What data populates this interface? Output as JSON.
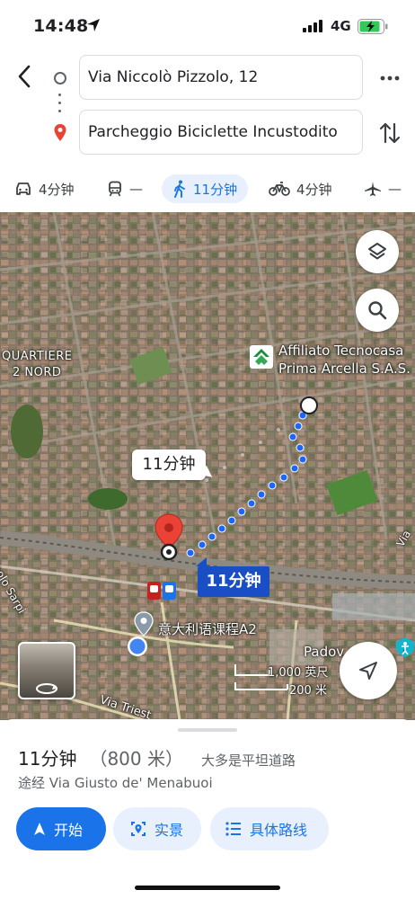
{
  "status_bar": {
    "time": "14:48",
    "network": "4G"
  },
  "route": {
    "origin": "Via Niccolò Pizzolo, 12",
    "destination": "Parcheggio Biciclette Incustodito"
  },
  "modes": [
    {
      "name": "drive",
      "icon": "car-icon",
      "label": "4分钟"
    },
    {
      "name": "transit",
      "icon": "train-icon",
      "label": "—"
    },
    {
      "name": "walk",
      "icon": "walk-icon",
      "label": "11分钟",
      "active": true
    },
    {
      "name": "bike",
      "icon": "bike-icon",
      "label": "4分钟"
    },
    {
      "name": "flight",
      "icon": "plane-icon",
      "label": "—"
    }
  ],
  "map": {
    "place_labels": {
      "quartiere_line1": "QUARTIERE",
      "quartiere_line2": "2 NORD",
      "poi_line1": "Affiliato Tecnocasa",
      "poi_line2": "Prima Arcella S.A.S.",
      "paolo_sarpi": "Paolo Sarpi",
      "course": "意大利语课程A2",
      "padova": "Padov",
      "via_trieste": "Via Triest",
      "right_road": "Via"
    },
    "callout_time": "11分钟",
    "route_badge": "11分钟",
    "scale": {
      "feet": "1,000 英尺",
      "meters": "200 米"
    },
    "colors": {
      "route": "#1a66ff",
      "pin": "#ea4335",
      "badge": "#1a4ec4"
    }
  },
  "sheet": {
    "duration": "11分钟",
    "distance": "（800 米）",
    "note": "大多是平坦道路",
    "via": "途经 Via Giusto de' Menabuoi",
    "buttons": {
      "start": "开始",
      "street_view": "实景",
      "steps": "具体路线"
    }
  },
  "colors": {
    "accent": "#1a73e8",
    "accent_bg": "#e8f0fe"
  }
}
